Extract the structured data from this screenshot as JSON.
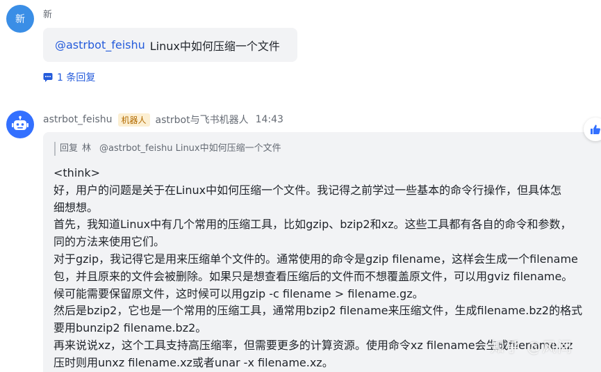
{
  "first_message": {
    "avatar_text": "新",
    "sender": "新",
    "mention": "@astrbot_feishu",
    "text": "Linux中如何压缩一个文件",
    "reply_count": "1 条回复"
  },
  "bot_message": {
    "sender": "astrbot_feishu",
    "badge": "机器人",
    "group": "astrbot与飞书机器人",
    "time": "14:43",
    "quote": {
      "prefix": "回复",
      "name": "林",
      "text": "@astrbot_feishu Linux中如何压缩一个文件"
    },
    "lines": [
      "<think>",
      "好，用户的问题是关于在Linux中如何压缩一个文件。我记得之前学过一些基本的命令行操作，但具体怎",
      "细想想。",
      "首先，我知道Linux中有几个常用的压缩工具，比如gzip、bzip2和xz。这些工具都有各自的命令和参数，",
      "同的方法来使用它们。",
      "对于gzip，我记得它是用来压缩单个文件的。通常使用的命令是gzip filename，这样会生成一个filename",
      "包，并且原来的文件会被删除。如果只是想查看压缩后的文件而不想覆盖原文件，可以用gviz filename。",
      "候可能需要保留原文件，这时候可以用gzip -c filename > filename.gz。",
      "然后是bzip2，它也是一个常用的压缩工具，通常用bzip2 filename来压缩文件，生成filename.bz2的格式",
      "要用bunzip2 filename.bz2。",
      "再来说说xz，这个工具支持高压缩率，但需要更多的计算资源。使用命令xz filename会生成filename.xz",
      "压时则用unxz filename.xz或者unar -x filename.xz。"
    ]
  },
  "watermark": "知乎 @风间"
}
